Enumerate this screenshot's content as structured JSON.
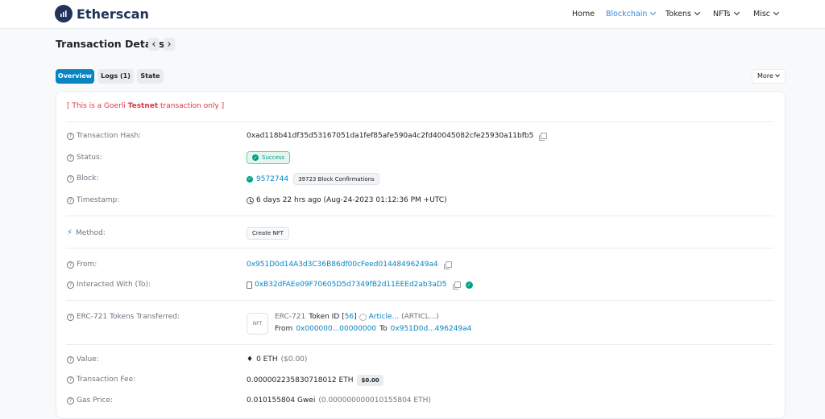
{
  "header": {
    "logo_text": "Etherscan",
    "nav": {
      "home": "Home",
      "blockchain": "Blockchain",
      "tokens": "Tokens",
      "nfts": "NFTs",
      "misc": "Misc"
    }
  },
  "page": {
    "title": "Transaction Details"
  },
  "tabs": {
    "overview": "Overview",
    "logs": "Logs (1)",
    "state": "State",
    "more": "More"
  },
  "notice": {
    "prefix": "[ This is a Goerli ",
    "bold": "Testnet",
    "suffix": " transaction only ]"
  },
  "fields": {
    "tx_hash": {
      "label": "Transaction Hash:",
      "value": "0xad118b41df35d53167051da1fef85afe590a4c2fd40045082cfe25930a11bfb5"
    },
    "status": {
      "label": "Status:",
      "value": "Success"
    },
    "block": {
      "label": "Block:",
      "value": "9572744",
      "confirmations": "39723 Block Confirmations"
    },
    "timestamp": {
      "label": "Timestamp:",
      "value": "6 days 22 hrs ago (Aug-24-2023 01:12:36 PM +UTC)"
    },
    "method": {
      "label": "Method:",
      "value": "Create NFT"
    },
    "from": {
      "label": "From:",
      "value": "0x951D0d14A3d3C36B86df00cFeed01448496249a4"
    },
    "to": {
      "label": "Interacted With (To):",
      "value": "0xB32dFAEe09F70605D5d7349fB2d11EEEd2ab3aD5"
    },
    "erc721": {
      "label": "ERC-721 Tokens Transferred:",
      "nft_box": "NFT",
      "line1_prefix": "ERC-721",
      "token_id_label": "Token ID [",
      "token_id": "56",
      "token_id_close": "]",
      "token_name": "Article...",
      "token_symbol": "(ARTICL...)",
      "from_label": "From",
      "from_addr": "0x000000...00000000",
      "to_label": "To",
      "to_addr": "0x951D0d...496249a4"
    },
    "value": {
      "label": "Value:",
      "value": "0 ETH",
      "usd": "($0.00)"
    },
    "fee": {
      "label": "Transaction Fee:",
      "value": "0.000002235830718012 ETH",
      "usd": "$0.00"
    },
    "gas_price": {
      "label": "Gas Price:",
      "value": "0.010155804 Gwei",
      "eth": "(0.000000000010155804 ETH)"
    }
  },
  "colors": {
    "primary": "#0784c3",
    "link": "#3b8ad1",
    "success": "#00a186",
    "danger": "#dc3545",
    "brand": "#21325b"
  }
}
